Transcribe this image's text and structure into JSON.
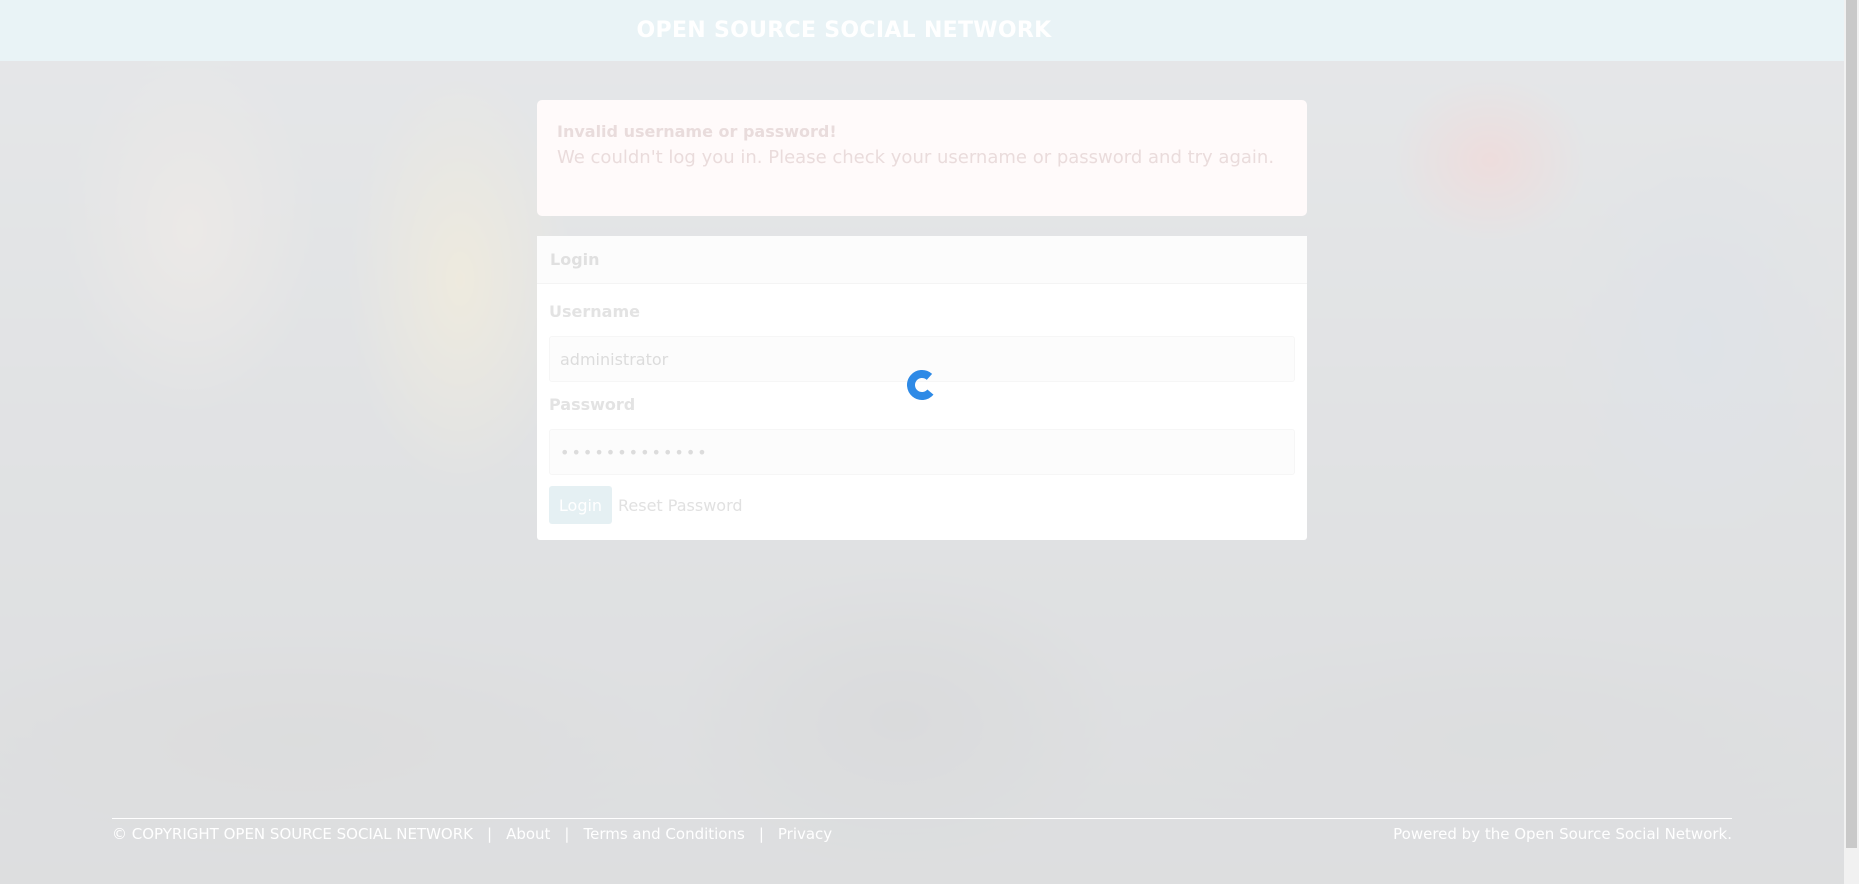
{
  "header": {
    "title": "OPEN SOURCE SOCIAL NETWORK"
  },
  "error": {
    "title": "Invalid username or password!",
    "message": "We couldn't log you in. Please check your username or password and try again."
  },
  "login": {
    "heading": "Login",
    "username_label": "Username",
    "username_value": "administrator",
    "password_label": "Password",
    "password_value": "•••••••••••••",
    "submit_label": "Login",
    "reset_label": "Reset Password"
  },
  "footer": {
    "copyright": "© COPYRIGHT OPEN SOURCE SOCIAL NETWORK",
    "separator": "|",
    "links": [
      "About",
      "Terms and Conditions",
      "Privacy"
    ],
    "powered_by": "Powered by the Open Source Social Network."
  },
  "colors": {
    "spinner": "#2e8ae6",
    "topbar": "#e9f3f6",
    "error_bg": "#fffafa"
  },
  "icons": {
    "loading": "loading-spinner-icon"
  }
}
